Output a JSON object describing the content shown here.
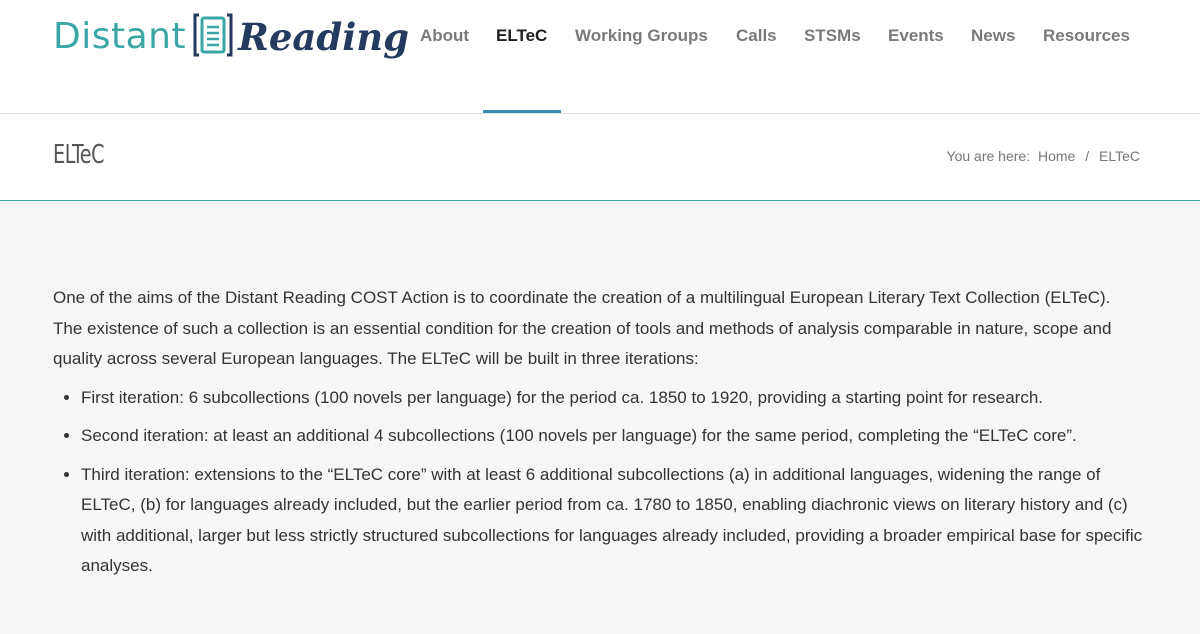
{
  "logo": {
    "text_left": "Distant",
    "text_right": "Reading",
    "icon": "document-icon",
    "colors": {
      "distant": "#3aa7a6",
      "reading": "#243a5e"
    }
  },
  "nav": {
    "items": [
      {
        "label": "About"
      },
      {
        "label": "ELTeC"
      },
      {
        "label": "Working Groups"
      },
      {
        "label": "Calls"
      },
      {
        "label": "STSMs"
      },
      {
        "label": "Events"
      },
      {
        "label": "News"
      },
      {
        "label": "Resources"
      }
    ],
    "active": "ELTeC",
    "accent": "#3a8fae"
  },
  "title_bar": {
    "title": "ELTeC",
    "breadcrumb": {
      "prefix": "You are here:",
      "items": [
        "Home",
        "ELTeC"
      ],
      "separator": "/"
    }
  },
  "content": {
    "intro": "One of the aims of the Distant Reading COST Action is to coordinate the creation of a multilingual European Literary Text Collection (ELTeC). The existence of such a collection is an essential condition for the creation of tools and methods of analysis comparable in nature, scope and quality across several European languages. The ELTeC will be built in three iterations:",
    "iterations": [
      "First iteration: 6 subcollections (100 novels per language) for the period ca. 1850 to 1920, providing a starting point for research.",
      "Second iteration: at least an additional 4 subcollections (100 novels per language) for the same period, completing the “ELTeC core”.",
      "Third iteration: extensions to the “ELTeC core” with at least 6 additional subcollections (a) in additional languages, widening the range of ELTeC, (b) for languages already included, but the earlier period from ca. 1780 to 1850, enabling diachronic views on literary history and (c) with additional, larger but less strictly structured subcollections for languages already included, providing a broader empirical base for specific analyses."
    ]
  }
}
